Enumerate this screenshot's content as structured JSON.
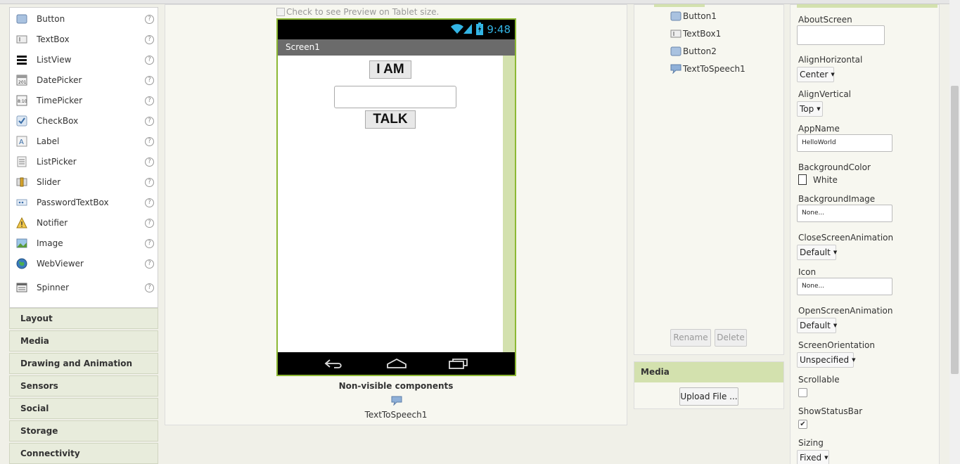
{
  "palette": {
    "items": [
      {
        "label": "Button",
        "icon": "button-icon"
      },
      {
        "label": "TextBox",
        "icon": "textbox-icon"
      },
      {
        "label": "ListView",
        "icon": "listview-icon"
      },
      {
        "label": "DatePicker",
        "icon": "datepicker-icon"
      },
      {
        "label": "TimePicker",
        "icon": "timepicker-icon"
      },
      {
        "label": "CheckBox",
        "icon": "checkbox-icon"
      },
      {
        "label": "Label",
        "icon": "label-icon"
      },
      {
        "label": "ListPicker",
        "icon": "listpicker-icon"
      },
      {
        "label": "Slider",
        "icon": "slider-icon"
      },
      {
        "label": "PasswordTextBox",
        "icon": "passwordtextbox-icon"
      },
      {
        "label": "Notifier",
        "icon": "notifier-icon"
      },
      {
        "label": "Image",
        "icon": "image-icon"
      },
      {
        "label": "WebViewer",
        "icon": "webviewer-icon"
      },
      {
        "label": "Spinner",
        "icon": "spinner-icon"
      }
    ],
    "help_symbol": "?",
    "categories": [
      "Layout",
      "Media",
      "Drawing and Animation",
      "Sensors",
      "Social",
      "Storage",
      "Connectivity"
    ]
  },
  "viewer": {
    "tablet_check_label": "Check to see Preview on Tablet size.",
    "clock": "9:48",
    "screen_title": "Screen1",
    "button1_text": "I AM",
    "button2_text": "TALK",
    "textbox_value": "",
    "nonvisible_title": "Non-visible components",
    "nonvisible_items": [
      "TextToSpeech1"
    ]
  },
  "components": {
    "items": [
      {
        "label": "Button1",
        "icon": "button-icon"
      },
      {
        "label": "TextBox1",
        "icon": "textbox-icon"
      },
      {
        "label": "Button2",
        "icon": "button-icon"
      },
      {
        "label": "TextToSpeech1",
        "icon": "speech-bubble-icon"
      }
    ],
    "rename_label": "Rename",
    "delete_label": "Delete"
  },
  "media": {
    "title": "Media",
    "upload_label": "Upload File ..."
  },
  "properties": {
    "about_screen_label": "AboutScreen",
    "about_screen_value": "",
    "align_horizontal_label": "AlignHorizontal",
    "align_horizontal_value": "Center",
    "align_vertical_label": "AlignVertical",
    "align_vertical_value": "Top",
    "app_name_label": "AppName",
    "app_name_value": "HelloWorld",
    "background_color_label": "BackgroundColor",
    "background_color_value": "White",
    "background_image_label": "BackgroundImage",
    "background_image_value": "None...",
    "close_anim_label": "CloseScreenAnimation",
    "close_anim_value": "Default",
    "icon_label": "Icon",
    "icon_value": "None...",
    "open_anim_label": "OpenScreenAnimation",
    "open_anim_value": "Default",
    "orientation_label": "ScreenOrientation",
    "orientation_value": "Unspecified",
    "scrollable_label": "Scrollable",
    "scrollable_checked": false,
    "show_status_label": "ShowStatusBar",
    "show_status_checked": true,
    "show_status_mark": "✔",
    "sizing_label": "Sizing",
    "sizing_value": "Fixed"
  },
  "colors": {
    "accent_green": "#8cb833",
    "panel_green": "#d3e1ae",
    "clock_blue": "#33b5e5"
  }
}
